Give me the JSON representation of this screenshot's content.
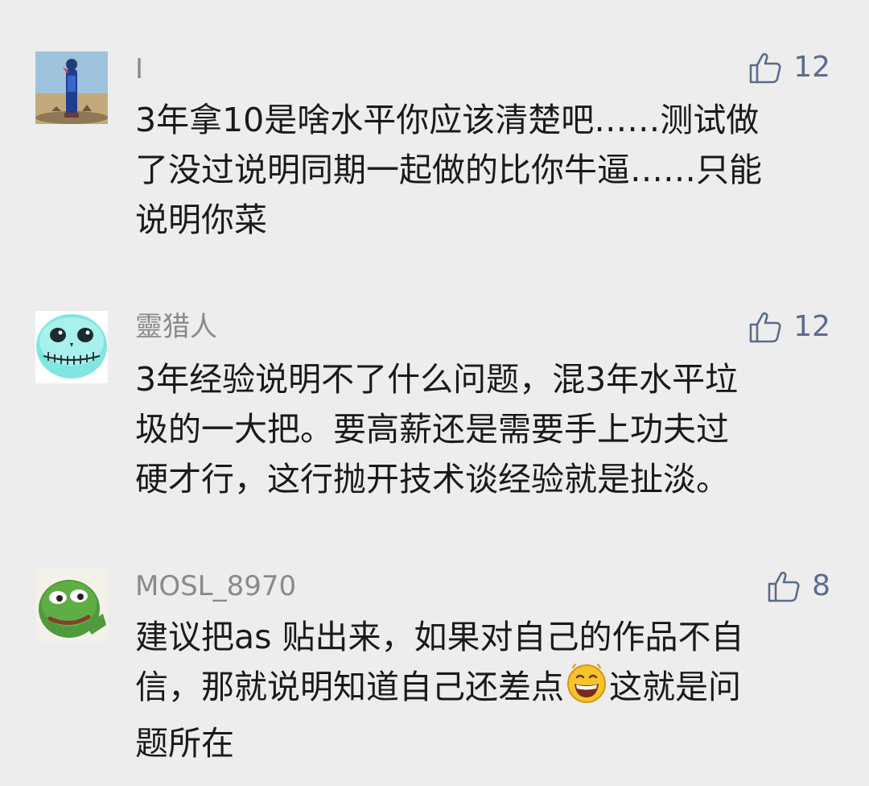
{
  "comments": [
    {
      "username": "I",
      "likes": "12",
      "lines": [
        "3年拿10是啥水平你应该清楚吧……测试做",
        "了没过说明同期一起做的比你牛逼……只能",
        "说明你菜"
      ]
    },
    {
      "username": "靈猎人",
      "likes": "12",
      "lines": [
        "3年经验说明不了什么问题，混3年水平垃",
        "圾的一大把。要高薪还是需要手上功夫过",
        "硬才行，这行抛开技术谈经验就是扯淡。"
      ]
    },
    {
      "username": "MOSL_8970",
      "likes": "8",
      "lines": [
        "建议把as 贴出来，如果对自己的作品不自",
        "信，那就说明知道自己还差点",
        "题所在"
      ],
      "line2_after_emoji": "这就是问"
    }
  ],
  "icons": {
    "like": "thumbs-up-icon",
    "emoji": "grinning-face-emoji"
  },
  "colors": {
    "background": "#ededed",
    "username": "#8a8a8a",
    "like": "#5b6b8c",
    "text": "#1a1a1a"
  }
}
